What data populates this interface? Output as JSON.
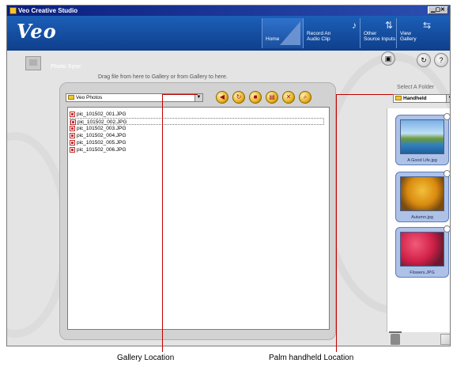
{
  "window": {
    "title": "Veo Creative Studio",
    "controls": "▁▢✕"
  },
  "header": {
    "logo": "Veo",
    "nav": [
      {
        "label": "Home",
        "icon": "home-icon"
      },
      {
        "label": "Record An\nAudio Clip",
        "icon": "microphone-icon"
      },
      {
        "label": "Other\nSource Inputs",
        "icon": "arrows-icon"
      },
      {
        "label": "View\nGallery",
        "icon": "gallery-icon"
      }
    ]
  },
  "photo_sync": {
    "title": "Photo Sync",
    "instruction": "Drag file from here to Gallery or from Gallery to here."
  },
  "gallery_panel": {
    "folder_value": "Veo Photos",
    "toolbar": [
      {
        "icon": "back-icon",
        "glyph": "◀"
      },
      {
        "icon": "refresh-icon",
        "glyph": "↻"
      },
      {
        "icon": "stop-icon",
        "glyph": "■"
      },
      {
        "icon": "folder-icon",
        "glyph": "▤"
      },
      {
        "icon": "delete-icon",
        "glyph": "✕"
      },
      {
        "icon": "search-icon",
        "glyph": "⌕"
      }
    ],
    "files": [
      "pic_101502_001.JPG",
      "pic_101502_002.JPG",
      "pic_101502_003.JPG",
      "pic_101502_004.JPG",
      "pic_101502_005.JPG",
      "pic_101502_006.JPG"
    ]
  },
  "handheld_panel": {
    "select_folder_label": "Select A Folder",
    "folder_value": "Handheld",
    "top_buttons": [
      {
        "icon": "palm-icon",
        "glyph": "▣"
      },
      {
        "icon": "sync-icon",
        "glyph": "↻"
      },
      {
        "icon": "help-icon",
        "glyph": "?"
      }
    ],
    "thumbnails": [
      {
        "caption": "A Good Life.jpg"
      },
      {
        "caption": "Autumn.jpg"
      },
      {
        "caption": "Flowers.JPG"
      }
    ]
  },
  "callouts": {
    "gallery_location": "Gallery Location",
    "palm_location": "Palm handheld Location"
  },
  "colors": {
    "callout_line": "#c00000",
    "header_blue": "#1c5fb8"
  }
}
